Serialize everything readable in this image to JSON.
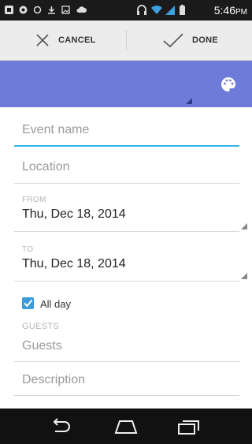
{
  "status_bar": {
    "time": "5:46",
    "time_suffix": "PM",
    "icons": [
      "bbm-icon",
      "notification-icon",
      "circle-icon",
      "download-icon",
      "image-icon",
      "upload-icon",
      "headset-icon",
      "wifi-icon",
      "signal-icon",
      "battery-icon"
    ]
  },
  "action_bar": {
    "cancel_label": "CANCEL",
    "done_label": "DONE"
  },
  "color_bar": {
    "color": "#6e7bd9",
    "icon": "palette-icon"
  },
  "form": {
    "event_name_placeholder": "Event name",
    "location_placeholder": "Location",
    "from_label": "FROM",
    "from_value": "Thu, Dec 18, 2014",
    "to_label": "TO",
    "to_value": "Thu, Dec 18, 2014",
    "all_day_label": "All day",
    "all_day_checked": true,
    "guests_label": "GUESTS",
    "guests_placeholder": "Guests",
    "description_placeholder": "Description"
  },
  "accent_color": "#33b5e5"
}
